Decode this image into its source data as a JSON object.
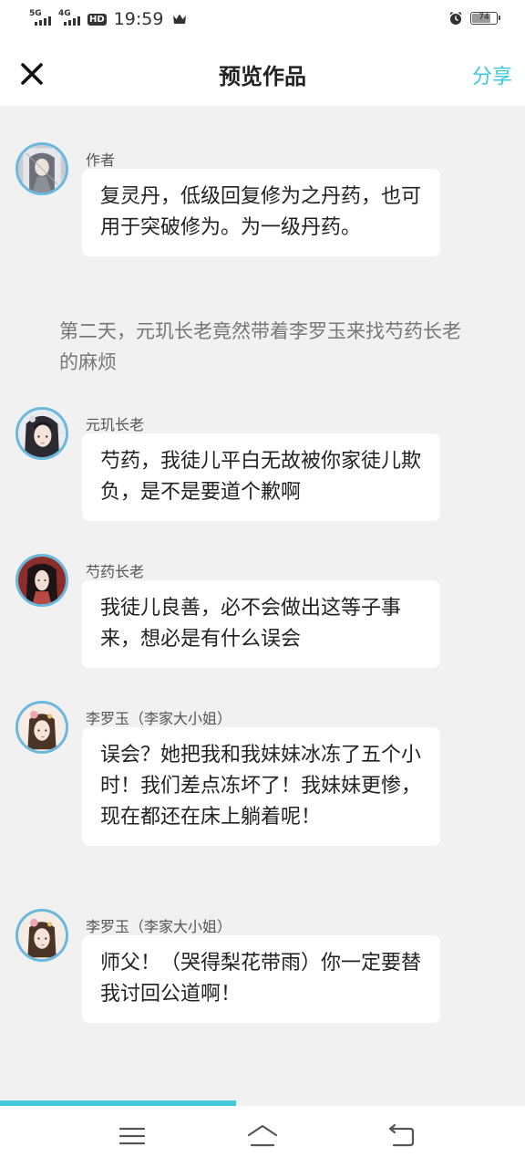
{
  "status_bar": {
    "network1": "5G",
    "network2": "4G",
    "hd_badge": "HD",
    "time": "19:59",
    "battery": "74",
    "icons": [
      "signal-icon",
      "crown-icon",
      "alarm-icon",
      "battery-icon"
    ]
  },
  "header": {
    "close_icon": "close-icon",
    "title": "预览作品",
    "share_label": "分享"
  },
  "messages": [
    {
      "type": "chat",
      "sender": "作者",
      "avatar": "author-avatar",
      "text": "复灵丹，低级回复修为之丹药，也可用于突破修为。为一级丹药。"
    },
    {
      "type": "narration",
      "text": "第二天，元玑长老竟然带着李罗玉来找芍药长老的麻烦"
    },
    {
      "type": "chat",
      "sender": "元玑长老",
      "avatar": "elder-yuanji-avatar",
      "text": "芍药，我徒儿平白无故被你家徒儿欺负，是不是要道个歉啊"
    },
    {
      "type": "chat",
      "sender": "芍药长老",
      "avatar": "elder-shaoyao-avatar",
      "text": "我徒儿良善，必不会做出这等子事来，想必是有什么误会"
    },
    {
      "type": "chat",
      "sender": "李罗玉（李家大小姐）",
      "avatar": "li-luoyu-avatar",
      "text": "误会？她把我和我妹妹冰冻了五个小时！我们差点冻坏了！我妹妹更惨，现在都还在床上躺着呢！"
    },
    {
      "type": "chat",
      "sender": "李罗玉（李家大小姐）",
      "avatar": "li-luoyu-avatar",
      "text": "师父！（哭得梨花带雨）你一定要替我讨回公道啊！"
    }
  ],
  "progress": {
    "fraction": 0.45,
    "color": "#44c9dd"
  },
  "nav_bar": {
    "icons": [
      "menu-icon",
      "home-icon",
      "back-icon"
    ]
  },
  "colors": {
    "accent": "#3ec7dc",
    "avatar_border": "#6ab8de",
    "background": "#f1f1f1"
  }
}
